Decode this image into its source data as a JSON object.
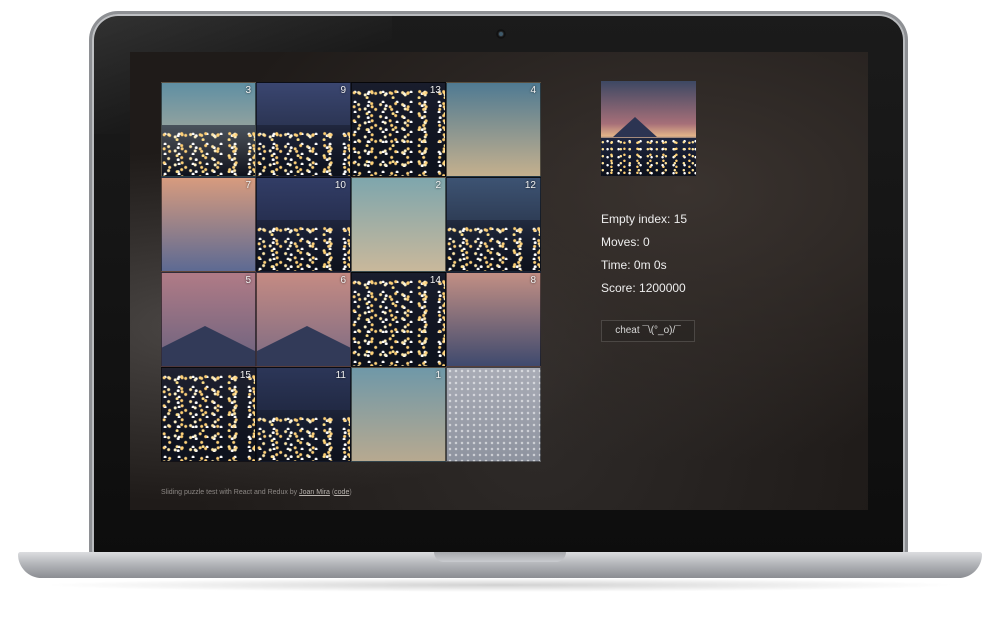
{
  "puzzle": {
    "tiles": [
      {
        "label": "3",
        "colors": [
          "#5f8fa3",
          "#c9b79a"
        ]
      },
      {
        "label": "9",
        "colors": [
          "#3a4670",
          "#1b2133"
        ]
      },
      {
        "label": "13",
        "colors": [
          "#1a1c28",
          "#0e0f16"
        ]
      },
      {
        "label": "4",
        "colors": [
          "#4f7a92",
          "#c4b08e"
        ]
      },
      {
        "label": "7",
        "colors": [
          "#d79b7e",
          "#5d6a93"
        ]
      },
      {
        "label": "10",
        "colors": [
          "#323d66",
          "#1a2038"
        ]
      },
      {
        "label": "2",
        "colors": [
          "#7ea6ad",
          "#c9b89b"
        ]
      },
      {
        "label": "12",
        "colors": [
          "#3d5373",
          "#1d2434"
        ]
      },
      {
        "label": "5",
        "colors": [
          "#b07b86",
          "#6a627f"
        ]
      },
      {
        "label": "6",
        "colors": [
          "#c58b83",
          "#7b6a83"
        ]
      },
      {
        "label": "14",
        "colors": [
          "#1a1d2a",
          "#0f1118"
        ]
      },
      {
        "label": "8",
        "colors": [
          "#c28f84",
          "#3f4a6e"
        ]
      },
      {
        "label": "15",
        "colors": [
          "#2a2732",
          "#151419"
        ]
      },
      {
        "label": "11",
        "colors": [
          "#2c3658",
          "#141a2c"
        ]
      },
      {
        "label": "1",
        "colors": [
          "#6f98a8",
          "#b7a990"
        ]
      },
      {
        "label": "",
        "colors": [
          "#a9acb6",
          "#8e939f"
        ]
      }
    ]
  },
  "stats": {
    "empty_index": "Empty index: 15",
    "moves": "Moves: 0",
    "time": "Time: 0m 0s",
    "score": "Score: 1200000"
  },
  "cheat_label": "cheat ¯\\(°_o)/¯",
  "footer": {
    "text": "Sliding puzzle test with React and Redux by ",
    "author": "Joan Mira",
    "open_paren": " (",
    "code_link": "code",
    "close_paren": ")"
  }
}
